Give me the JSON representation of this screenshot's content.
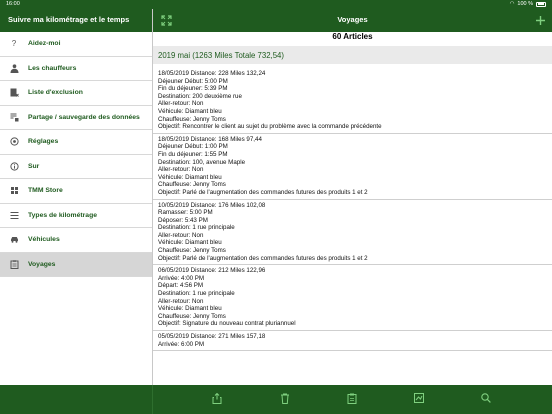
{
  "status": {
    "time": "16:00",
    "battery": "100 %"
  },
  "sidebar": {
    "title": "Suivre ma kilométrage et le temps",
    "items": [
      {
        "label": "Aidez-moi",
        "icon": "question-icon"
      },
      {
        "label": "Les chauffeurs",
        "icon": "driver-icon"
      },
      {
        "label": "Liste d'exclusion",
        "icon": "exclusion-list-icon"
      },
      {
        "label": "Partage / sauvegarde des données",
        "icon": "share-backup-icon"
      },
      {
        "label": "Réglages",
        "icon": "settings-icon"
      },
      {
        "label": "Sur",
        "icon": "info-icon"
      },
      {
        "label": "TMM Store",
        "icon": "store-icon"
      },
      {
        "label": "Types de kilométrage",
        "icon": "list-icon"
      },
      {
        "label": "Véhicules",
        "icon": "car-icon"
      },
      {
        "label": "Voyages",
        "icon": "clipboard-icon"
      }
    ]
  },
  "main": {
    "title": "Voyages",
    "count": "60 Articles",
    "section": "2019 mai (1263 Miles Totale 732,54)",
    "trips": [
      {
        "lines": [
          "18/05/2019 Distance: 228 Miles 132,24",
          "Déjeuner Début: 5:00 PM",
          "Fin du déjeuner: 5:39 PM",
          "Destination: 200 deuxième rue",
          "Aller-retour: Non",
          "Véhicule: Diamant bleu",
          "Chauffeuse: Jenny Toms",
          "Objectif: Rencontrer le client au sujet du problème avec la commande précédente"
        ]
      },
      {
        "lines": [
          "18/05/2019 Distance: 168 Miles 97,44",
          "Déjeuner Début: 1:00 PM",
          "Fin du déjeuner: 1:55 PM",
          "Destination: 100, avenue Maple",
          "Aller-retour: Non",
          "Véhicule: Diamant bleu",
          "Chauffeuse: Jenny Toms",
          "Objectif: Parlé de l'augmentation des commandes futures des produits 1 et 2"
        ]
      },
      {
        "lines": [
          "10/05/2019 Distance: 176 Miles 102,08",
          "Ramasser: 5:00 PM",
          "Déposer: 5:43 PM",
          "Destination: 1 rue principale",
          "Aller-retour: Non",
          "Véhicule: Diamant bleu",
          "Chauffeuse: Jenny Toms",
          "Objectif: Parlé de l'augmentation des commandes futures des produits 1 et 2"
        ]
      },
      {
        "lines": [
          "06/05/2019 Distance: 212 Miles 122,96",
          "Arrivée: 4:00 PM",
          "Départ: 4:56 PM",
          "Destination: 1 rue principale",
          "Aller-retour: Non",
          "Véhicule: Diamant bleu",
          "Chauffeuse: Jenny Toms",
          "Objectif: Signature du nouveau contrat pluriannuel"
        ]
      },
      {
        "lines": [
          "05/05/2019 Distance: 271 Miles 157,18",
          "Arrivée: 6:00 PM"
        ]
      }
    ]
  },
  "toolbar": {
    "icons": [
      "share-icon",
      "trash-icon",
      "clipboard-icon",
      "map-icon",
      "search-icon"
    ]
  },
  "colors": {
    "header": "#1f5b1f",
    "accent": "#7fd07f",
    "label": "#1f5b1f"
  }
}
